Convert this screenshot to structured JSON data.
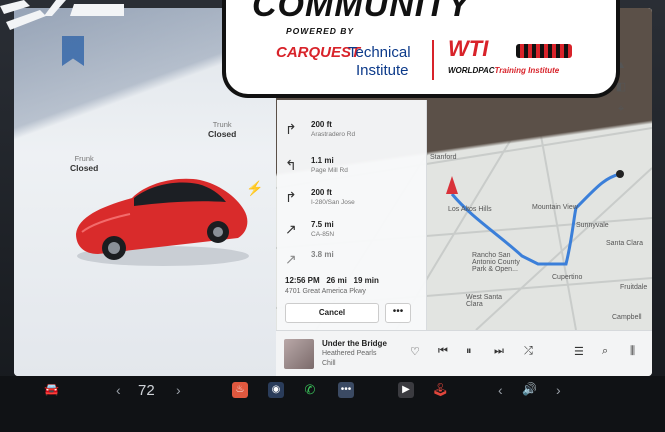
{
  "overlay": {
    "title": "COMMUNITY",
    "powered_by": "POWERED BY",
    "carquest_red": "CARQUEST",
    "carquest_blue": "Technical",
    "carquest_institute": "Institute",
    "wti": "WTI",
    "wti_sub_black": "WORLDPAC",
    "wti_sub_red": "Training Institute"
  },
  "car": {
    "frunk_label": "Frunk",
    "frunk_state": "Closed",
    "trunk_label": "Trunk",
    "trunk_state": "Closed",
    "body_color": "#d92b2b"
  },
  "navigation": {
    "turns": [
      {
        "distance": "200 ft",
        "road": "Arastradero Rd",
        "icon": "turn-right-icon"
      },
      {
        "distance": "1.1 mi",
        "road": "Page Mill Rd",
        "icon": "turn-left-icon"
      },
      {
        "distance": "200 ft",
        "road": "I-280/San Jose",
        "icon": "turn-right-icon"
      },
      {
        "distance": "7.5 mi",
        "road": "CA-85N",
        "icon": "bear-right-icon"
      },
      {
        "distance": "3.8 mi",
        "road": "",
        "icon": "bear-right-icon"
      }
    ],
    "eta_arrival": "12:56 PM",
    "eta_distance": "26 mi",
    "eta_duration": "19 min",
    "destination": "4701 Great America Pkwy",
    "cancel_label": "Cancel",
    "more_label": "•••",
    "route_color": "#3b7fd9"
  },
  "map": {
    "places": [
      "Stanford",
      "Los Altos Hills",
      "Mountain View",
      "Sunnyvale",
      "Santa Clara",
      "Rancho San Antonio County Park & Open...",
      "Cupertino",
      "West Santa Clara",
      "Campbell",
      "Fruitdale"
    ]
  },
  "media": {
    "song": "Under the Bridge",
    "artist": "Heathered Pearls",
    "station": "Chill"
  },
  "taskbar": {
    "temperature": "72",
    "temp_left": "‹",
    "temp_right": "›",
    "vol_left": "‹",
    "vol_right": "›"
  }
}
